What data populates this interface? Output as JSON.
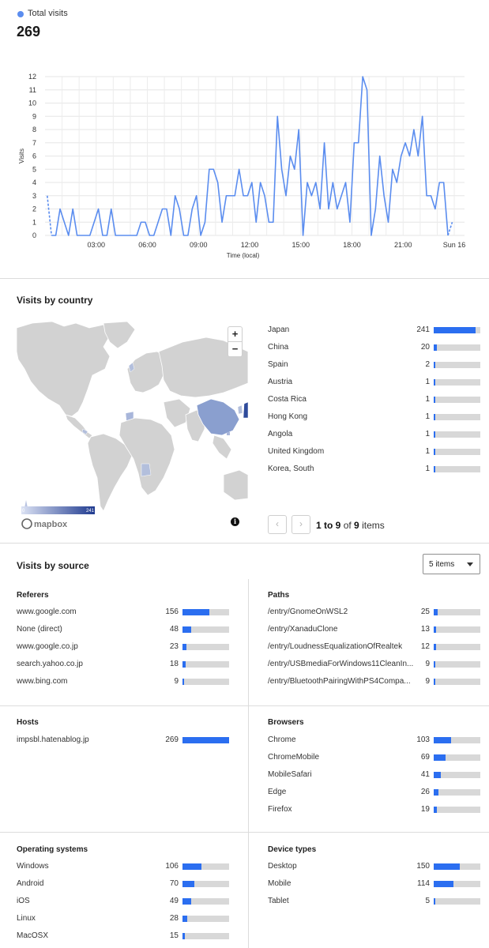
{
  "summary": {
    "legend_label": "Total visits",
    "total": "269",
    "accent": "#5b8def"
  },
  "chart_data": {
    "type": "line",
    "ylabel": "Visits",
    "xlabel": "Time (local)",
    "ylim": [
      0,
      12
    ],
    "yticks": [
      "0",
      "1",
      "2",
      "3",
      "4",
      "5",
      "6",
      "7",
      "8",
      "9",
      "10",
      "11",
      "12"
    ],
    "xticks": [
      {
        "label": "03:00",
        "h": 3
      },
      {
        "label": "06:00",
        "h": 6
      },
      {
        "label": "09:00",
        "h": 9
      },
      {
        "label": "12:00",
        "h": 12
      },
      {
        "label": "15:00",
        "h": 15
      },
      {
        "label": "18:00",
        "h": 18
      },
      {
        "label": "21:00",
        "h": 21
      },
      {
        "label": "Sun 16",
        "h": 24
      }
    ],
    "x_start_hours": 0.13,
    "x_step_hours": 0.25,
    "values": [
      3,
      0,
      0,
      2,
      1,
      0,
      2,
      0,
      0,
      0,
      0,
      1,
      2,
      0,
      0,
      2,
      0,
      0,
      0,
      0,
      0,
      0,
      1,
      1,
      0,
      0,
      1,
      2,
      2,
      0,
      3,
      2,
      0,
      0,
      2,
      3,
      0,
      1,
      5,
      5,
      4,
      1,
      3,
      3,
      3,
      5,
      3,
      3,
      4,
      1,
      4,
      3,
      1,
      1,
      9,
      5,
      3,
      6,
      5,
      8,
      0,
      4,
      3,
      4,
      2,
      7,
      2,
      4,
      2,
      3,
      4,
      1,
      7,
      7,
      12,
      11,
      0,
      2,
      6,
      3,
      1,
      5,
      4,
      6,
      7,
      6,
      8,
      6,
      9,
      3,
      3,
      2,
      4,
      4,
      0,
      1
    ],
    "grid": true,
    "series_color": "#5b8def"
  },
  "country": {
    "title": "Visits by country",
    "rows": [
      {
        "label": "Japan",
        "count": "241",
        "frac": 0.9
      },
      {
        "label": "China",
        "count": "20",
        "frac": 0.075
      },
      {
        "label": "Spain",
        "count": "2",
        "frac": 0.02
      },
      {
        "label": "Austria",
        "count": "1",
        "frac": 0.012
      },
      {
        "label": "Costa Rica",
        "count": "1",
        "frac": 0.012
      },
      {
        "label": "Hong Kong",
        "count": "1",
        "frac": 0.012
      },
      {
        "label": "Angola",
        "count": "1",
        "frac": 0.012
      },
      {
        "label": "United Kingdom",
        "count": "1",
        "frac": 0.012
      },
      {
        "label": "Korea, South",
        "count": "1",
        "frac": 0.012
      }
    ],
    "map": {
      "zoom_in": "+",
      "zoom_out": "−",
      "scale_min": "0",
      "scale_max": "241",
      "logo": "mapbox",
      "info": "i"
    },
    "pager": {
      "prev": "‹",
      "next": "›",
      "range": "1 to 9",
      "of": "of",
      "total": "9",
      "items": "items"
    }
  },
  "source": {
    "title": "Visits by source",
    "select_value": "5 items"
  },
  "panels": {
    "referers": {
      "title": "Referers",
      "rows": [
        {
          "label": "www.google.com",
          "count": "156",
          "frac": 0.58
        },
        {
          "label": "None (direct)",
          "count": "48",
          "frac": 0.18
        },
        {
          "label": "www.google.co.jp",
          "count": "23",
          "frac": 0.09
        },
        {
          "label": "search.yahoo.co.jp",
          "count": "18",
          "frac": 0.07
        },
        {
          "label": "www.bing.com",
          "count": "9",
          "frac": 0.035
        }
      ]
    },
    "paths": {
      "title": "Paths",
      "rows": [
        {
          "label": "/entry/GnomeOnWSL2",
          "count": "25",
          "frac": 0.093
        },
        {
          "label": "/entry/XanaduClone",
          "count": "13",
          "frac": 0.05
        },
        {
          "label": "/entry/LoudnessEqualizationOfRealtek",
          "count": "12",
          "frac": 0.045
        },
        {
          "label": "/entry/USBmediaForWindows11CleanIn...",
          "count": "9",
          "frac": 0.035
        },
        {
          "label": "/entry/BluetoothPairingWithPS4Compa...",
          "count": "9",
          "frac": 0.035
        }
      ]
    },
    "hosts": {
      "title": "Hosts",
      "rows": [
        {
          "label": "impsbl.hatenablog.jp",
          "count": "269",
          "frac": 1.0
        }
      ]
    },
    "browsers": {
      "title": "Browsers",
      "rows": [
        {
          "label": "Chrome",
          "count": "103",
          "frac": 0.38
        },
        {
          "label": "ChromeMobile",
          "count": "69",
          "frac": 0.26
        },
        {
          "label": "MobileSafari",
          "count": "41",
          "frac": 0.15
        },
        {
          "label": "Edge",
          "count": "26",
          "frac": 0.1
        },
        {
          "label": "Firefox",
          "count": "19",
          "frac": 0.07
        }
      ]
    },
    "os": {
      "title": "Operating systems",
      "rows": [
        {
          "label": "Windows",
          "count": "106",
          "frac": 0.4
        },
        {
          "label": "Android",
          "count": "70",
          "frac": 0.26
        },
        {
          "label": "iOS",
          "count": "49",
          "frac": 0.18
        },
        {
          "label": "Linux",
          "count": "28",
          "frac": 0.1
        },
        {
          "label": "MacOSX",
          "count": "15",
          "frac": 0.055
        }
      ]
    },
    "devices": {
      "title": "Device types",
      "rows": [
        {
          "label": "Desktop",
          "count": "150",
          "frac": 0.56
        },
        {
          "label": "Mobile",
          "count": "114",
          "frac": 0.42
        },
        {
          "label": "Tablet",
          "count": "5",
          "frac": 0.02
        }
      ]
    }
  }
}
